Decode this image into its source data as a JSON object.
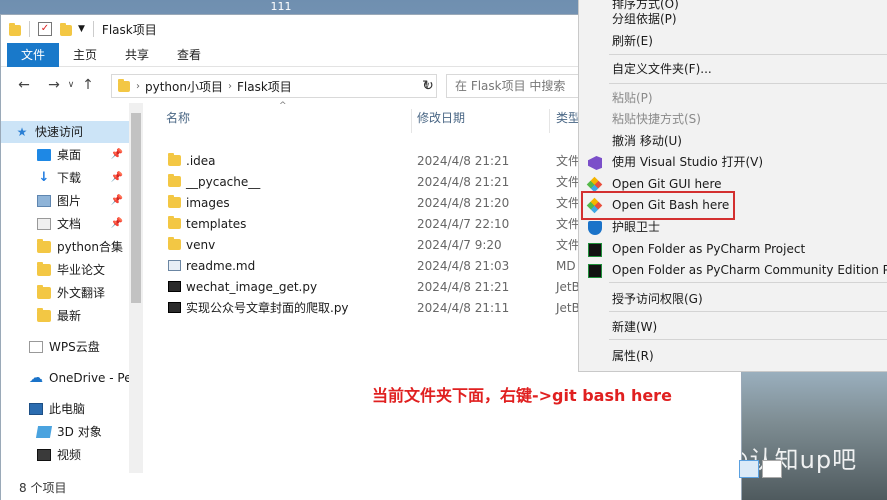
{
  "desktop": {
    "top_text": "111",
    "watermark": "知乎 @认知up吧"
  },
  "window": {
    "title": "Flask项目",
    "ribbon_tabs": [
      "文件",
      "主页",
      "共享",
      "查看"
    ],
    "address": {
      "crumbs": [
        "python小项目",
        "Flask项目"
      ]
    },
    "search_placeholder": "在 Flask项目 中搜索",
    "columns": {
      "name": "名称",
      "date": "修改日期",
      "type": "类型"
    },
    "files": [
      {
        "name": ".idea",
        "date": "2024/4/8 21:21",
        "type": "文件",
        "icon": "folder-icon"
      },
      {
        "name": "__pycache__",
        "date": "2024/4/8 21:21",
        "type": "文件",
        "icon": "folder-icon"
      },
      {
        "name": "images",
        "date": "2024/4/8 21:20",
        "type": "文件",
        "icon": "folder-icon"
      },
      {
        "name": "templates",
        "date": "2024/4/7 22:10",
        "type": "文件",
        "icon": "folder-icon"
      },
      {
        "name": "venv",
        "date": "2024/4/7 9:20",
        "type": "文件",
        "icon": "folder-icon"
      },
      {
        "name": "readme.md",
        "date": "2024/4/8 21:03",
        "type": "MD",
        "icon": "markdown-file-icon"
      },
      {
        "name": "wechat_image_get.py",
        "date": "2024/4/8 21:21",
        "type": "JetB",
        "icon": "python-file-icon"
      },
      {
        "name": "实现公众号文章封面的爬取.py",
        "date": "2024/4/8 21:11",
        "type": "JetB",
        "icon": "python-file-icon"
      }
    ],
    "sidebar": [
      {
        "label": "快速访问",
        "icon": "star-icon",
        "pinned": false
      },
      {
        "label": "桌面",
        "icon": "desktop-icon",
        "pinned": true
      },
      {
        "label": "下载",
        "icon": "download-icon",
        "pinned": true
      },
      {
        "label": "图片",
        "icon": "pictures-icon",
        "pinned": true
      },
      {
        "label": "文档",
        "icon": "documents-icon",
        "pinned": true
      },
      {
        "label": "python合集",
        "icon": "folder-icon",
        "pinned": false
      },
      {
        "label": "毕业论文",
        "icon": "folder-icon",
        "pinned": false
      },
      {
        "label": "外文翻译",
        "icon": "folder-icon",
        "pinned": false
      },
      {
        "label": "最新",
        "icon": "folder-icon",
        "pinned": false
      },
      {
        "label": "WPS云盘",
        "icon": "wps-cloud-icon",
        "pinned": false
      },
      {
        "label": "OneDrive - Per",
        "icon": "onedrive-icon",
        "pinned": false
      },
      {
        "label": "此电脑",
        "icon": "this-pc-icon",
        "pinned": false
      },
      {
        "label": "3D 对象",
        "icon": "3d-objects-icon",
        "pinned": false
      },
      {
        "label": "视频",
        "icon": "videos-icon",
        "pinned": false
      }
    ],
    "status": "8 个项目"
  },
  "annotation": "当前文件夹下面，右键->git bash here",
  "context_menu": {
    "items": [
      {
        "label": "排序方式(O)",
        "disabled": false
      },
      {
        "label": "分组依据(P)",
        "disabled": false
      },
      {
        "label": "刷新(E)",
        "disabled": false
      },
      {
        "label": "自定义文件夹(F)...",
        "disabled": false
      },
      {
        "label": "粘贴(P)",
        "disabled": true
      },
      {
        "label": "粘贴快捷方式(S)",
        "disabled": true
      },
      {
        "label": "撤消 移动(U)",
        "disabled": false
      },
      {
        "label": "使用 Visual Studio 打开(V)",
        "disabled": false,
        "icon": "visual-studio-icon"
      },
      {
        "label": "Open Git GUI here",
        "disabled": false,
        "icon": "git-icon"
      },
      {
        "label": "Open Git Bash here",
        "disabled": false,
        "icon": "git-icon",
        "highlighted": true
      },
      {
        "label": "护眼卫士",
        "disabled": false,
        "icon": "shield-icon"
      },
      {
        "label": "Open Folder as PyCharm Project",
        "disabled": false,
        "icon": "pycharm-icon"
      },
      {
        "label": "Open Folder as PyCharm Community Edition Proje",
        "disabled": false,
        "icon": "pycharm-icon"
      },
      {
        "label": "授予访问权限(G)",
        "disabled": false
      },
      {
        "label": "新建(W)",
        "disabled": false
      },
      {
        "label": "属性(R)",
        "disabled": false
      }
    ],
    "highlight_color": "#d32f2f"
  },
  "colors": {
    "accent": "#1979ca",
    "selection": "#cce4f7",
    "annotation": "#e02020"
  }
}
